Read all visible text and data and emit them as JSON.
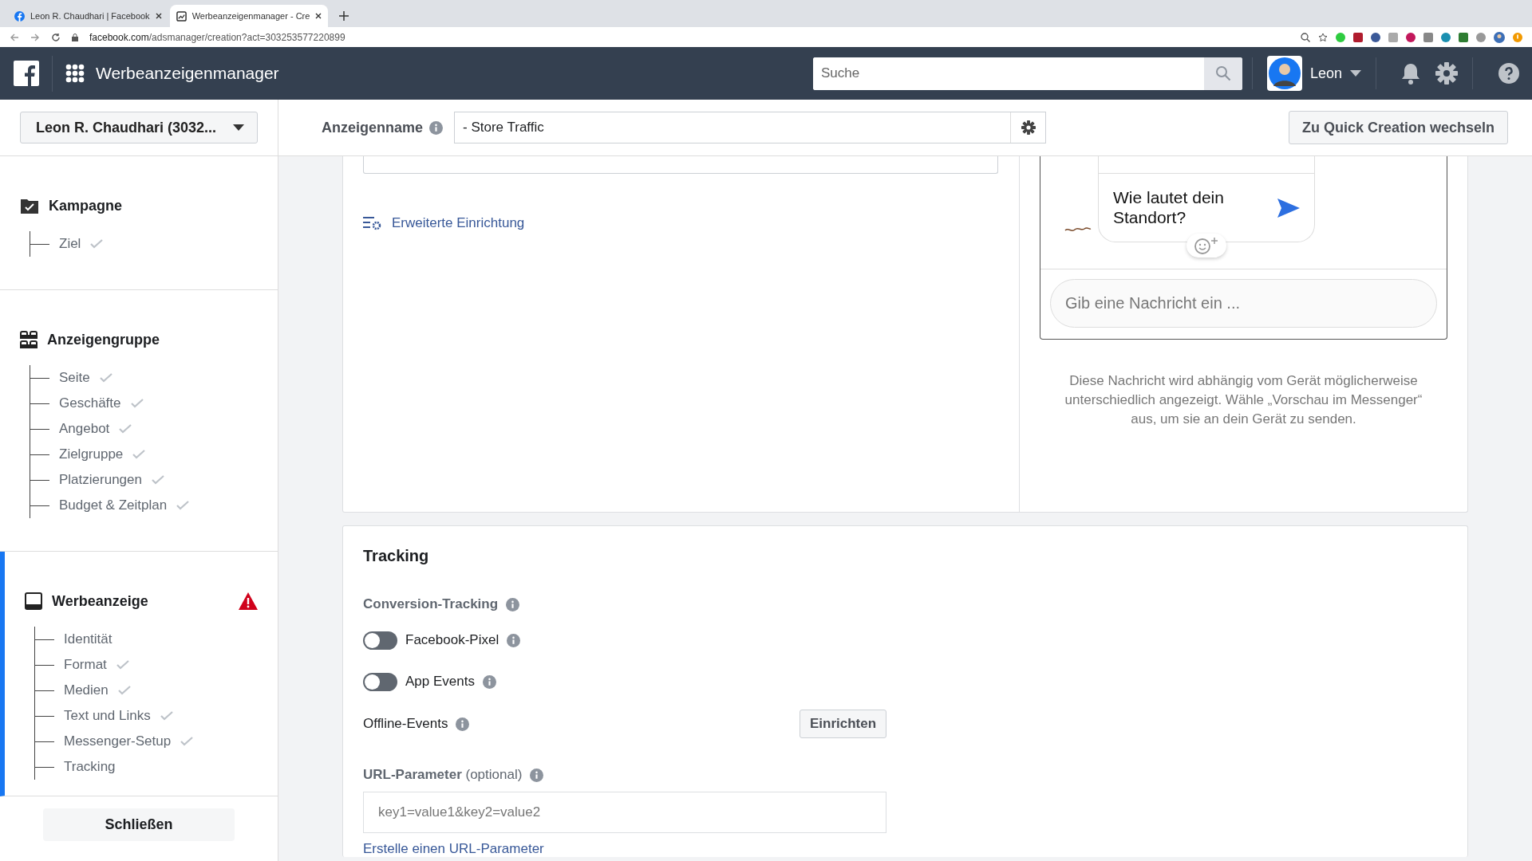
{
  "browser": {
    "tabs": [
      {
        "title": "Leon R. Chaudhari | Facebook",
        "kind": "facebook",
        "selected": false
      },
      {
        "title": "Werbeanzeigenmanager - Cre",
        "kind": "ads",
        "selected": true
      }
    ],
    "url_host": "facebook.com",
    "url_path": "/adsmanager/creation?act=303253577220899"
  },
  "header": {
    "app_title": "Werbeanzeigenmanager",
    "search_placeholder": "Suche",
    "user_name": "Leon"
  },
  "toolbar": {
    "account": "Leon R. Chaudhari (3032...",
    "ad_name_label": "Anzeigenname",
    "ad_name_value": "- Store Traffic",
    "switch_button": "Zu Quick Creation wechseln"
  },
  "sidebar": {
    "sections": [
      {
        "title": "Kampagne",
        "kind": "campaign",
        "selected": false,
        "warning": false,
        "children": [
          {
            "label": "Ziel",
            "done": true
          }
        ]
      },
      {
        "title": "Anzeigengruppe",
        "kind": "adset",
        "selected": false,
        "warning": false,
        "children": [
          {
            "label": "Seite",
            "done": true
          },
          {
            "label": "Geschäfte",
            "done": true
          },
          {
            "label": "Angebot",
            "done": true
          },
          {
            "label": "Zielgruppe",
            "done": true
          },
          {
            "label": "Platzierungen",
            "done": true
          },
          {
            "label": "Budget & Zeitplan",
            "done": true
          }
        ]
      },
      {
        "title": "Werbeanzeige",
        "kind": "ad",
        "selected": true,
        "warning": true,
        "children": [
          {
            "label": "Identität",
            "done": false
          },
          {
            "label": "Format",
            "done": true
          },
          {
            "label": "Medien",
            "done": true
          },
          {
            "label": "Text und Links",
            "done": true
          },
          {
            "label": "Messenger-Setup",
            "done": true
          },
          {
            "label": "Tracking",
            "done": false
          }
        ]
      }
    ],
    "close_button": "Schließen"
  },
  "creative": {
    "advanced_link": "Erweiterte Einrichtung",
    "preview": {
      "message": "Wie lautet dein Standort?",
      "composer_placeholder": "Gib eine Nachricht ein ...",
      "note": "Diese Nachricht wird abhängig vom Gerät möglicherweise unterschiedlich angezeigt. Wähle „Vorschau im Messenger“ aus, um sie an dein Gerät zu senden."
    }
  },
  "tracking": {
    "title": "Tracking",
    "section_label": "Conversion-Tracking",
    "toggles": [
      {
        "label": "Facebook-Pixel",
        "on": false
      },
      {
        "label": "App Events",
        "on": false
      }
    ],
    "offline_label": "Offline-Events",
    "offline_button": "Einrichten",
    "url_label": "URL-Parameter",
    "url_label_hint": "(optional)",
    "url_placeholder": "key1=value1&key2=value2",
    "url_link": "Erstelle einen URL-Parameter"
  }
}
